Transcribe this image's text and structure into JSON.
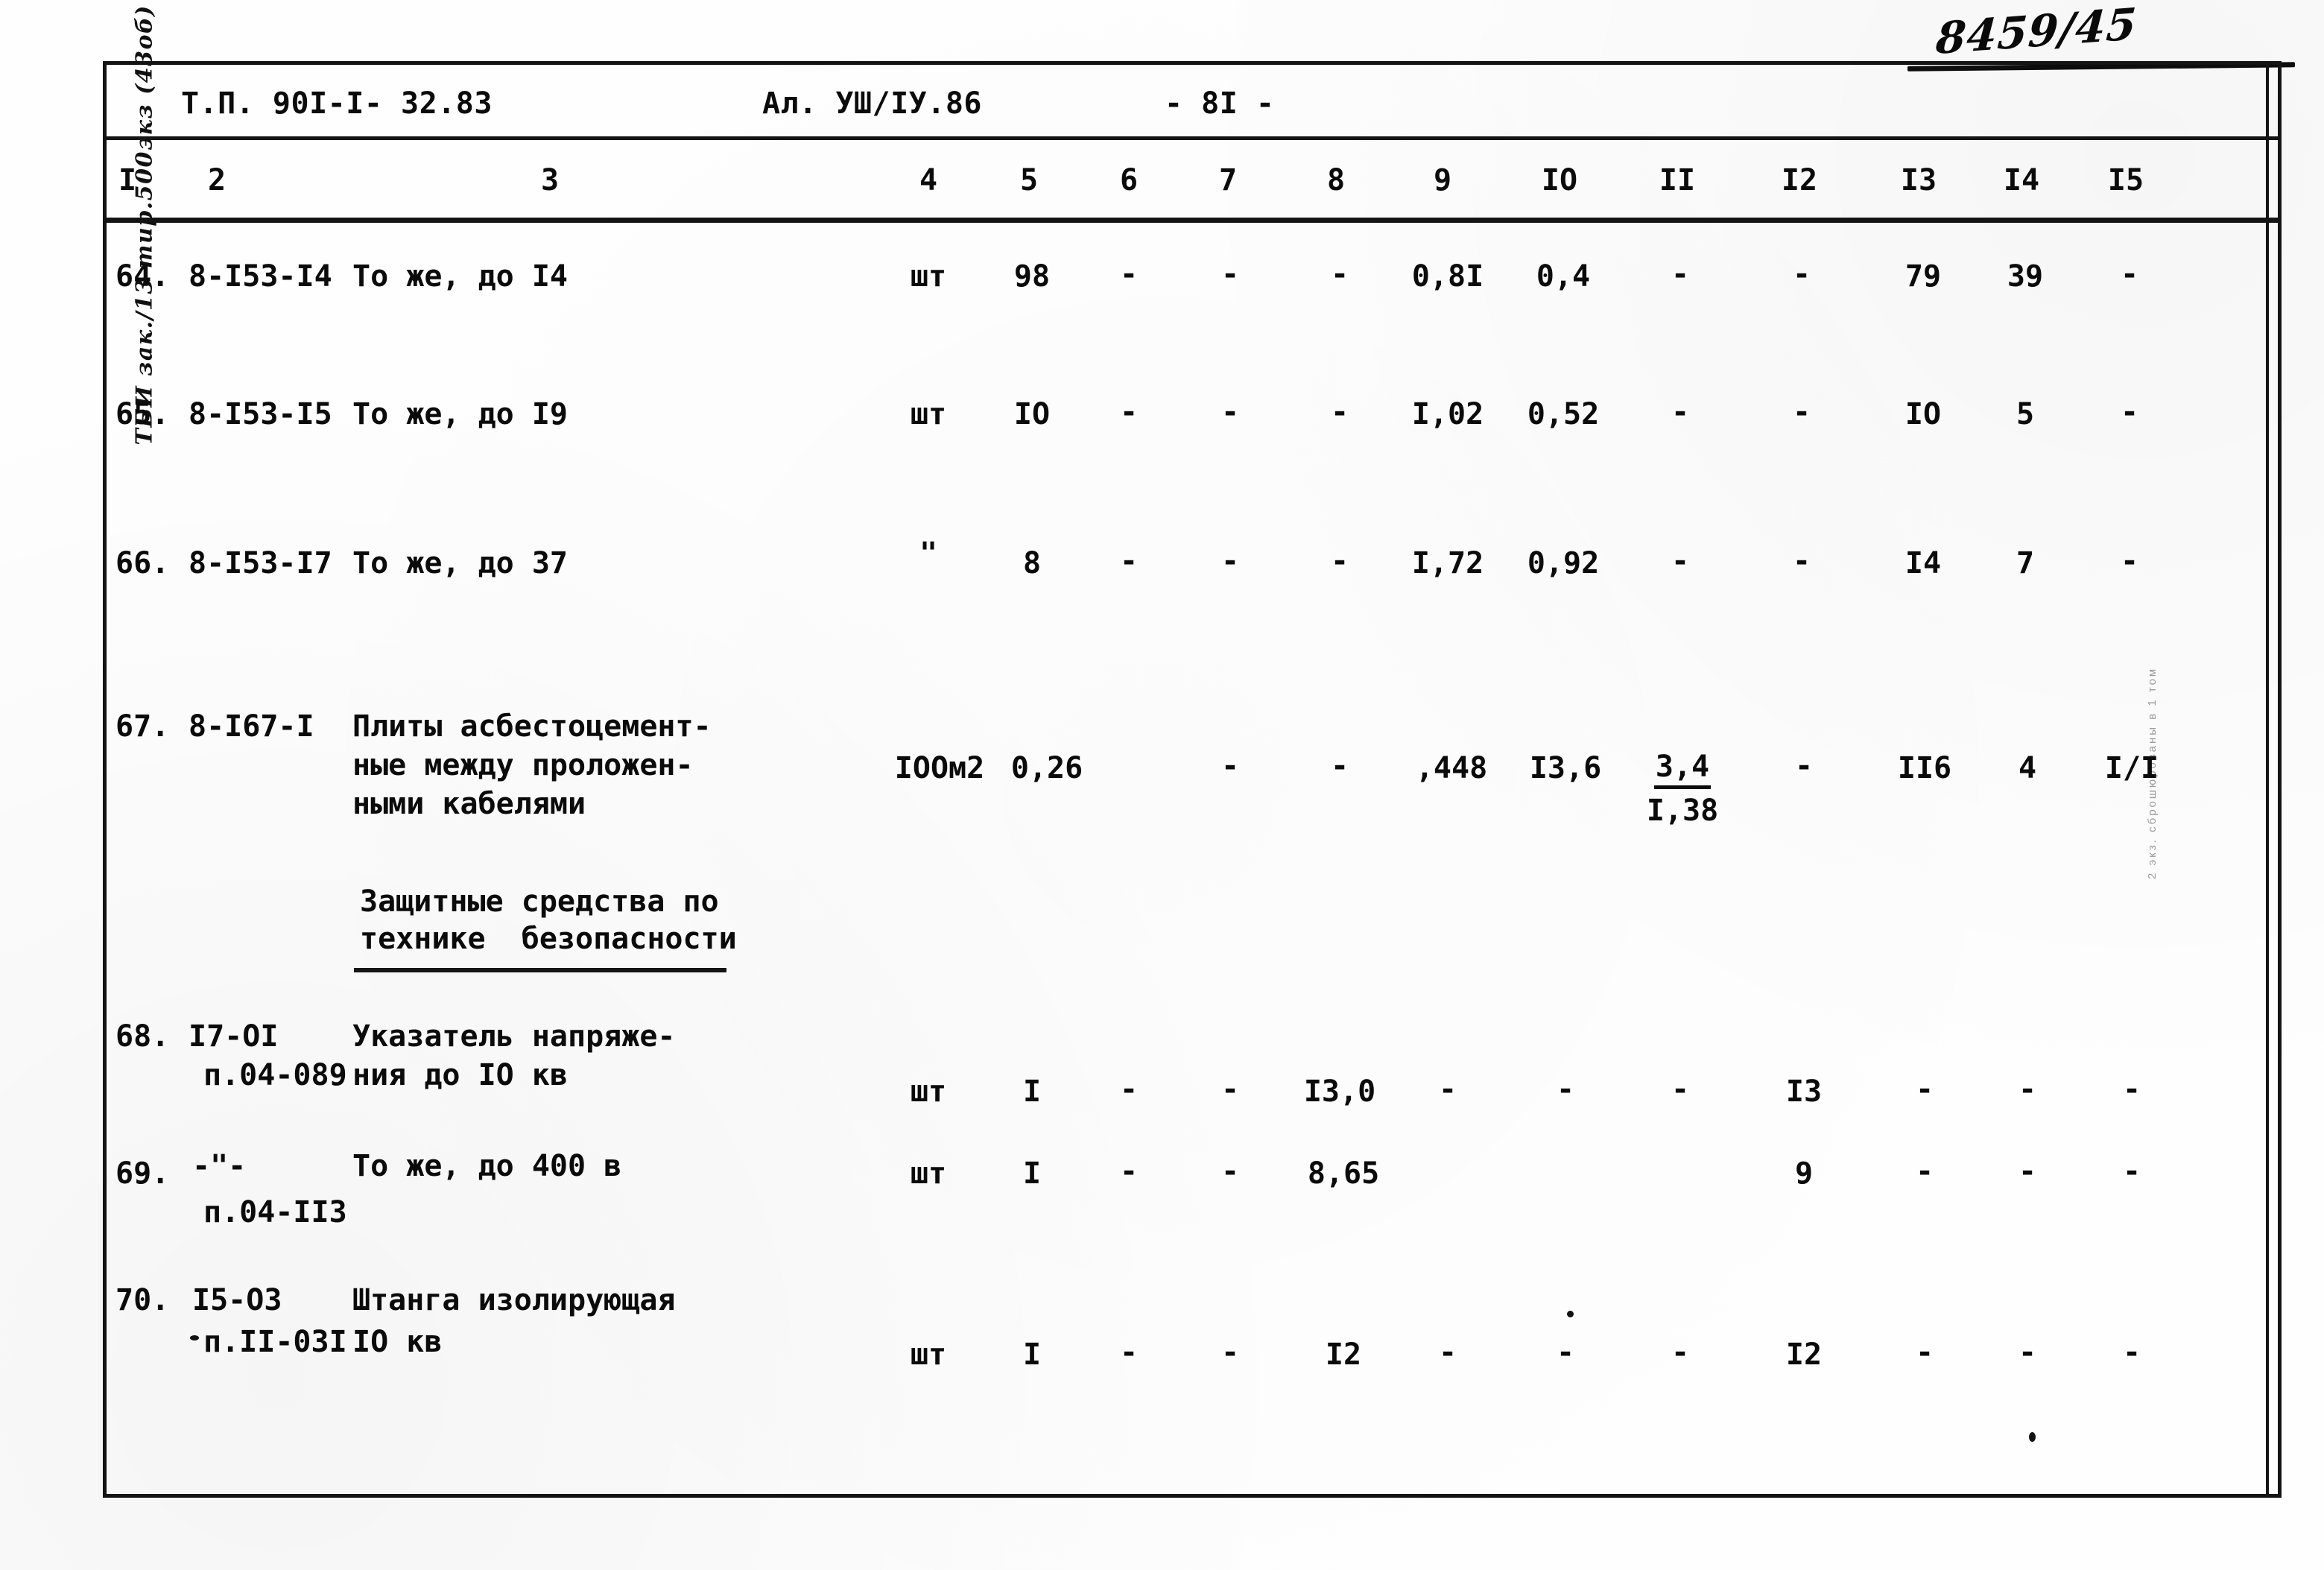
{
  "page": {
    "handwritten_number": "8459/45",
    "margin_note_left": "ТБИ зак./13 тир.500экз (43об)",
    "margin_note_right": "2 экз. сброшюрованы в 1 том"
  },
  "header": {
    "project_code": "Т.П. 90I-I- 32.83",
    "album": "Ал. УШ/IУ.86",
    "page_number": "- 8I -"
  },
  "column_numbers": [
    "I",
    "2",
    "3",
    "4",
    "5",
    "6",
    "7",
    "8",
    "9",
    "IO",
    "II",
    "I2",
    "I3",
    "I4",
    "I5"
  ],
  "section_heading": {
    "line1": "Защитные средства по",
    "line2": "технике  безопасности"
  },
  "rows": [
    {
      "num": "64.",
      "code": "8-I53-I4",
      "desc": [
        "То же, до I4"
      ],
      "unit": "шт",
      "c5": "98",
      "c6": "-",
      "c7": "-",
      "c8": "-",
      "c9": "0,8I",
      "c10": "0,4",
      "c11": "-",
      "c12": "-",
      "c13": "79",
      "c14": "39",
      "c15": "-"
    },
    {
      "num": "65.",
      "code": "8-I53-I5",
      "desc": [
        "То же, до I9"
      ],
      "unit": "шт",
      "c5": "IO",
      "c6": "-",
      "c7": "-",
      "c8": "-",
      "c9": "I,02",
      "c10": "0,52",
      "c11": "-",
      "c12": "-",
      "c13": "IO",
      "c14": "5",
      "c15": "-"
    },
    {
      "num": "66.",
      "code": "8-I53-I7",
      "desc": [
        "То же, до 37"
      ],
      "unit": "\"",
      "c5": "8",
      "c6": "-",
      "c7": "-",
      "c8": "-",
      "c9": "I,72",
      "c10": "0,92",
      "c11": "-",
      "c12": "-",
      "c13": "I4",
      "c14": "7",
      "c15": "-"
    },
    {
      "num": "67.",
      "code": "8-I67-I",
      "desc": [
        "Плиты асбестоцемент-",
        "ные между проложен-",
        "ными кабелями"
      ],
      "unit": "IOOм2",
      "c5": "0,26",
      "c6": "",
      "c7": "-",
      "c8": "-",
      "c9": ",448",
      "c10": "I3,6",
      "c11_num": "3,4",
      "c11_den": "I,38",
      "c12": "-",
      "c13": "II6",
      "c14": "4",
      "c15": "I/I"
    },
    {
      "num": "68.",
      "code": "I7-OI",
      "code2": "п.04-089",
      "desc": [
        "Указатель напряже-",
        "ния до IO кв"
      ],
      "unit": "шт",
      "c5": "I",
      "c6": "-",
      "c7": "-",
      "c8": "I3,0",
      "c9": "-",
      "c10": "-",
      "c11": "-",
      "c12": "I3",
      "c13": "-",
      "c14": "-",
      "c15": "-"
    },
    {
      "num": "69.",
      "code": "-\"-",
      "code2": "п.04-II3",
      "desc": [
        "То же, до 400 в"
      ],
      "unit": "шт",
      "c5": "I",
      "c6": "-",
      "c7": "-",
      "c8": "8,65",
      "c9": "",
      "c10": "",
      "c11": "",
      "c12": "9",
      "c13": "-",
      "c14": "-",
      "c15": "-"
    },
    {
      "num": "70.",
      "code": "I5-O3",
      "code2": "п.II-03I",
      "desc": [
        "Штанга изолирующая",
        "IO кв"
      ],
      "unit": "шт",
      "c5": "I",
      "c6": "-",
      "c7": "-",
      "c8": "I2",
      "c9": "-",
      "c10": "-",
      "c11": "-",
      "c12": "I2",
      "c13": "-",
      "c14": "-",
      "c15": "-"
    }
  ]
}
